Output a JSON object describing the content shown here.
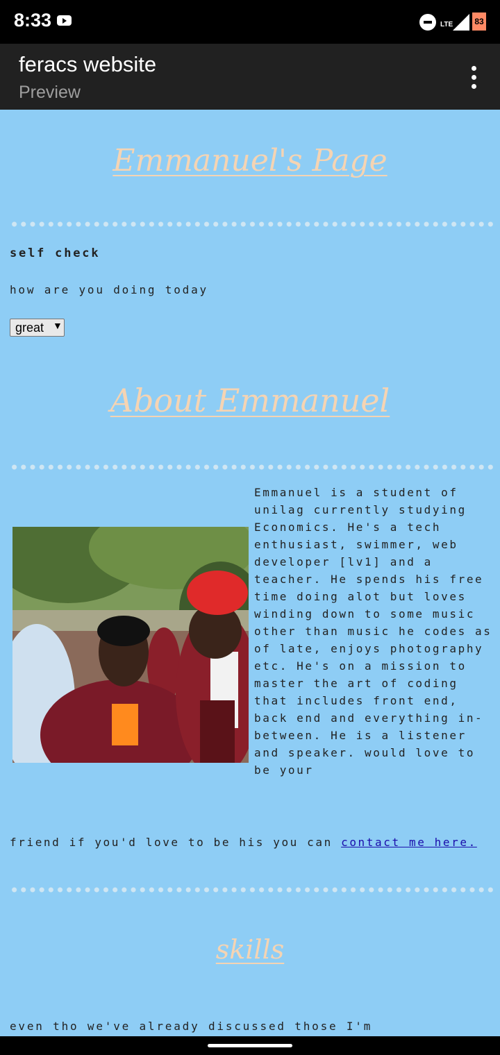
{
  "status_bar": {
    "time": "8:33",
    "network": "LTE",
    "battery": "83"
  },
  "app_bar": {
    "title": "feracs website",
    "subtitle": "Preview"
  },
  "page": {
    "title": "Emmanuel's Page",
    "self_check": {
      "heading": "self check",
      "question": "how are you doing today",
      "selected": "great",
      "arrow": "▼"
    },
    "about": {
      "heading": "About Emmanuel",
      "bio": "Emmanuel is a student of unilag currently studying Economics. He's a tech enthusiast, swimmer, web developer [lv1] and a teacher. He spends his free time doing alot but loves winding down to some music other than music he codes as of late, enjoys photography etc. He's on a mission to master the art of coding that includes front end, back end and everything in-between. He is a listener and speaker. would love to be your",
      "bio_continued": "friend if you'd love to be his you can ",
      "contact_link": "contact me here."
    },
    "skills": {
      "heading": "skills",
      "intro": "even tho we've already discussed those I'm"
    }
  },
  "colors": {
    "background": "#8ecdf5",
    "heading": "#f5d4b3",
    "link": "#1a0dab"
  }
}
